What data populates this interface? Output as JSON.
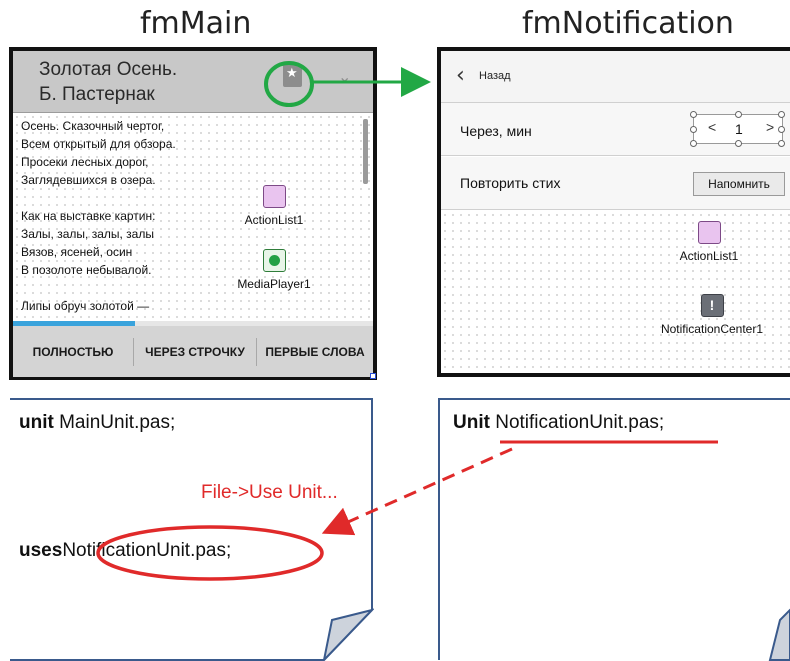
{
  "headings": {
    "main": "fmMain",
    "notification": "fmNotification"
  },
  "main_form": {
    "title_line1": "Золотая Осень.",
    "title_line2": "Б. Пастернак",
    "icons": {
      "bookmark": "bookmark-star-icon",
      "dropdown": "chevron-down-icon"
    },
    "poem_lines": [
      "Осень. Сказочный чертог,",
      "Всем открытый для обзора.",
      "Просеки лесных дорог,",
      "Заглядевшихся в озера.",
      "",
      "Как на выставке картин:",
      "Залы, залы, залы, залы",
      "Вязов, ясеней, осин",
      "В позолоте небывалой.",
      "",
      "Липы обруч золотой —"
    ],
    "progress": 0.34,
    "components": [
      {
        "label": "ActionList1",
        "icon": "action-list-icon"
      },
      {
        "label": "MediaPlayer1",
        "icon": "media-player-icon"
      }
    ],
    "buttons": [
      "ПОЛНОСТЬЮ",
      "ЧЕРЕЗ СТРОЧКУ",
      "ПЕРВЫЕ СЛОВА"
    ]
  },
  "notification_form": {
    "back_label": "Назад",
    "delay_label": "Через, мин",
    "stepper": {
      "decrement": "<",
      "value": "1",
      "increment": ">"
    },
    "repeat_label": "Повторить стих",
    "remind_button": "Напомнить",
    "components": [
      {
        "label": "ActionList1",
        "icon": "action-list-icon"
      },
      {
        "label": "NotificationCenter1",
        "icon": "notification-center-icon"
      }
    ]
  },
  "main_unit_code": {
    "unit_keyword": "unit",
    "unit_name": "MainUnit.pas;",
    "uses_keyword": "uses",
    "uses_name": "NotificationUnit.pas;",
    "annotation": "File->Use Unit..."
  },
  "notification_unit_code": {
    "unit_keyword": "Unit",
    "unit_name": "NotificationUnit.pas;"
  },
  "colors": {
    "annotation_red": "#e02a2a",
    "highlight_green": "#22a845",
    "progress_blue": "#3aa3dc",
    "panel_border": "#3a5a8c"
  }
}
